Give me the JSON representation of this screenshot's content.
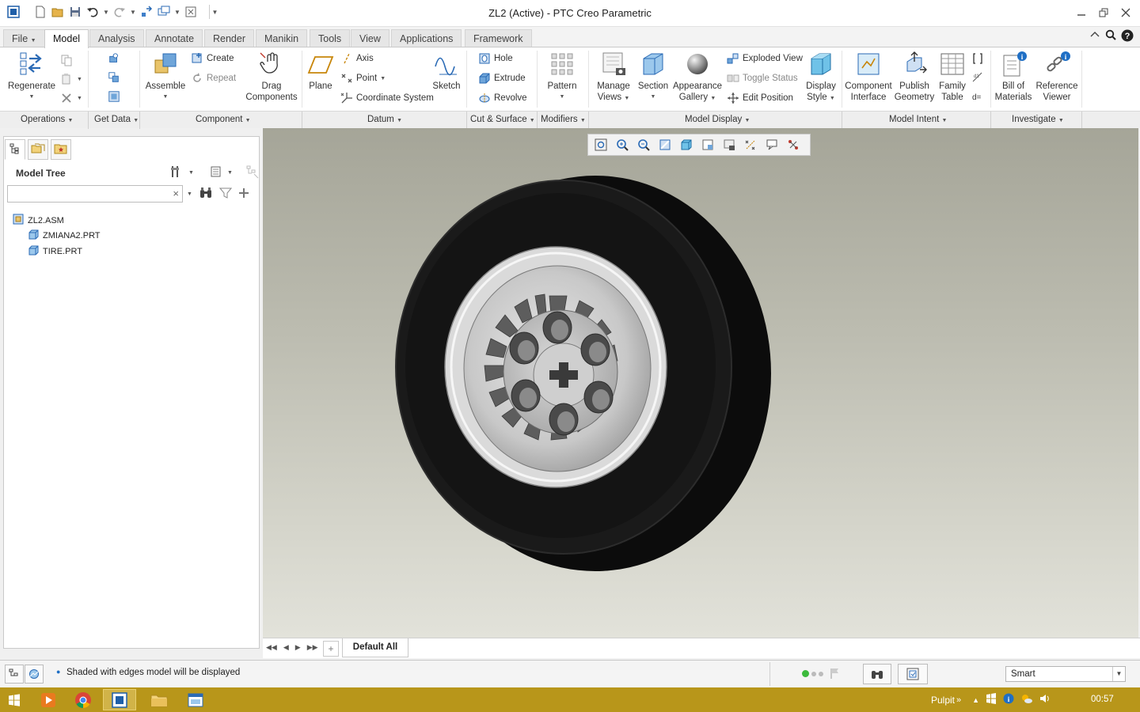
{
  "window": {
    "title": "ZL2 (Active) - PTC Creo Parametric"
  },
  "tabs": [
    "File",
    "Model",
    "Analysis",
    "Annotate",
    "Render",
    "Manikin",
    "Tools",
    "View",
    "Applications",
    "Framework"
  ],
  "active_tab": "Model",
  "ribbon": {
    "regenerate": "Regenerate",
    "assemble": "Assemble",
    "create": "Create",
    "repeat": "Repeat",
    "drag_components_1": "Drag",
    "drag_components_2": "Components",
    "plane": "Plane",
    "axis": "Axis",
    "point": "Point",
    "coordinate_system": "Coordinate System",
    "sketch": "Sketch",
    "hole": "Hole",
    "extrude": "Extrude",
    "revolve": "Revolve",
    "pattern": "Pattern",
    "manage_views_1": "Manage",
    "manage_views_2": "Views",
    "section": "Section",
    "appearance_gallery_1": "Appearance",
    "appearance_gallery_2": "Gallery",
    "exploded_view": "Exploded View",
    "toggle_status": "Toggle Status",
    "edit_position": "Edit Position",
    "display_style_1": "Display",
    "display_style_2": "Style",
    "component_interface_1": "Component",
    "component_interface_2": "Interface",
    "publish_geometry_1": "Publish",
    "publish_geometry_2": "Geometry",
    "family_table_1": "Family",
    "family_table_2": "Table",
    "bill_of_materials_1": "Bill of",
    "bill_of_materials_2": "Materials",
    "reference_viewer_1": "Reference",
    "reference_viewer_2": "Viewer"
  },
  "groups": {
    "operations": "Operations",
    "get_data": "Get Data",
    "component": "Component",
    "datum": "Datum",
    "cut_surface": "Cut & Surface",
    "modifiers": "Modifiers",
    "model_display": "Model Display",
    "model_intent": "Model Intent",
    "investigate": "Investigate"
  },
  "model_tree": {
    "header": "Model Tree",
    "search_value": "",
    "items": [
      {
        "label": "ZL2.ASM",
        "level": 0
      },
      {
        "label": "ZMIANA2.PRT",
        "level": 1
      },
      {
        "label": "TIRE.PRT",
        "level": 1
      }
    ]
  },
  "navigator": {
    "view_tab": "Default All"
  },
  "status": {
    "message": "Shaded with edges model will be displayed",
    "filter_value": "Smart"
  },
  "taskbar": {
    "tray_label": "Pulpit",
    "tray_chevron": "»",
    "clock": "00:57"
  },
  "colors": {
    "taskbar": "#b8961a",
    "accent_blue": "#1f6fc5",
    "viewport_top": "#a5a598",
    "viewport_bottom": "#e2e2da"
  }
}
